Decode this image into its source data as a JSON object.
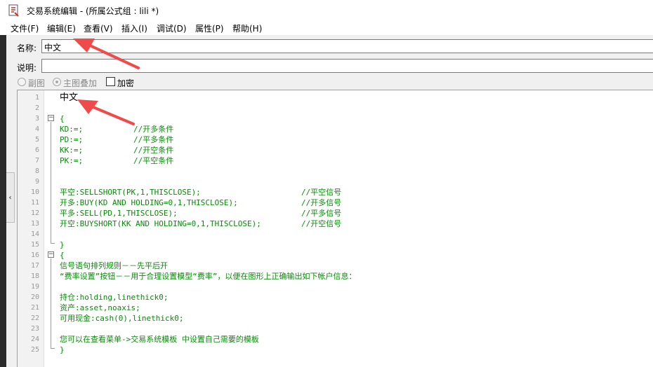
{
  "window": {
    "title": "交易系统编辑 - (所属公式组 : lili *)"
  },
  "menu": [
    {
      "label": "文件(F)"
    },
    {
      "label": "编辑(E)"
    },
    {
      "label": "查看(V)"
    },
    {
      "label": "插入(I)"
    },
    {
      "label": "调试(D)"
    },
    {
      "label": "属性(P)"
    },
    {
      "label": "帮助(H)"
    }
  ],
  "form": {
    "name_label": "名称:",
    "name_value": "中文",
    "desc_label": "说明:",
    "desc_value": "",
    "radio_sub": "副图",
    "radio_main": "主图叠加",
    "checkbox_encrypt": "加密"
  },
  "collapse_glyph": "‹",
  "editor": {
    "lines": [
      {
        "n": "1",
        "code": "中文",
        "comment": ""
      },
      {
        "n": "2",
        "code": "",
        "comment": ""
      },
      {
        "n": "3",
        "code": "{",
        "comment": ""
      },
      {
        "n": "4",
        "code": "KD:=;",
        "comment": "//开多条件"
      },
      {
        "n": "5",
        "code": "PD:=;",
        "comment": "//平多条件"
      },
      {
        "n": "6",
        "code": "KK:=;",
        "comment": "//开空条件"
      },
      {
        "n": "7",
        "code": "PK:=;",
        "comment": "//平空条件"
      },
      {
        "n": "8",
        "code": "",
        "comment": ""
      },
      {
        "n": "9",
        "code": "",
        "comment": ""
      },
      {
        "n": "10",
        "code": "平空:SELLSHORT(PK,1,THISCLOSE);",
        "comment": "//平空信号"
      },
      {
        "n": "11",
        "code": "开多:BUY(KD AND HOLDING=0,1,THISCLOSE);",
        "comment": "//开多信号"
      },
      {
        "n": "12",
        "code": "平多:SELL(PD,1,THISCLOSE);",
        "comment": "//平多信号"
      },
      {
        "n": "13",
        "code": "开空:BUYSHORT(KK AND HOLDING=0,1,THISCLOSE);",
        "comment": "//开空信号"
      },
      {
        "n": "14",
        "code": "",
        "comment": ""
      },
      {
        "n": "15",
        "code": "}",
        "comment": ""
      },
      {
        "n": "16",
        "code": "{",
        "comment": ""
      },
      {
        "n": "17",
        "code": "信号语句排列规则－－先平后开",
        "comment": ""
      },
      {
        "n": "18",
        "code": "“费率设置”按钮－－用于合理设置模型“费率”，以便在图形上正确输出如下帐户信息：",
        "comment": ""
      },
      {
        "n": "19",
        "code": "",
        "comment": ""
      },
      {
        "n": "20",
        "code": "持仓:holding,linethick0;",
        "comment": ""
      },
      {
        "n": "21",
        "code": "资产:asset,noaxis;",
        "comment": ""
      },
      {
        "n": "22",
        "code": "可用现金:cash(0),linethick0;",
        "comment": ""
      },
      {
        "n": "23",
        "code": "",
        "comment": ""
      },
      {
        "n": "24",
        "code": "您可以在查看菜单->交易系统模板 中设置自己需要的模板",
        "comment": ""
      },
      {
        "n": "25",
        "code": "}",
        "comment": ""
      }
    ]
  },
  "colors": {
    "code_green": "#0a8a0a",
    "annotation_arrow": "#f04a4a"
  }
}
